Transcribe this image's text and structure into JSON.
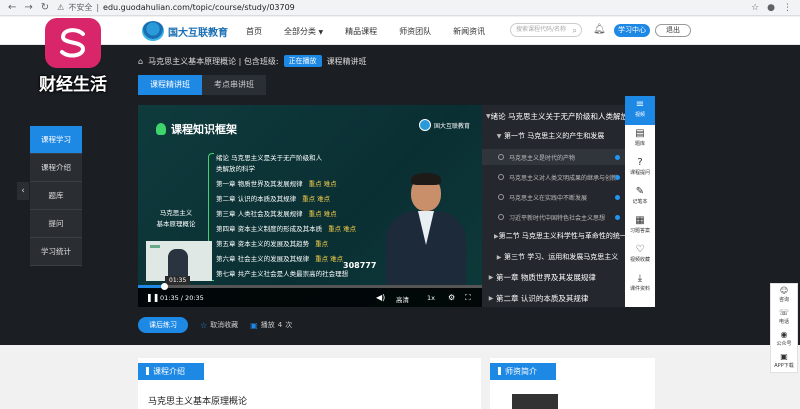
{
  "browser": {
    "security": "不安全",
    "url": "edu.guodahulian.com/topic/course/study/03709"
  },
  "watermark": {
    "text": "财经生活"
  },
  "header": {
    "logo_text": "国大互联教育",
    "nav": [
      "首页",
      "全部分类",
      "精品课程",
      "师资团队",
      "新闻资讯"
    ],
    "search_placeholder": "搜索课程代码/名称",
    "study_center": "学习中心",
    "exit": "退出"
  },
  "breadcrumb": {
    "course": "马克思主义基本原理概论 | 包含班级:",
    "status": "正在播放",
    "class": "课程精讲班"
  },
  "tabs": [
    "课程精讲班",
    "考点串讲班"
  ],
  "left_menu": [
    "课程学习",
    "课程介绍",
    "题库",
    "提问",
    "学习统计"
  ],
  "video": {
    "slide_title": "课程知识框架",
    "logo_text": "国大互联教育",
    "subject_line1": "马克思主义",
    "subject_line2": "基本原理概论",
    "outline": [
      {
        "text": "绪论  马克思主义是关于无产阶级和人",
        "keys": ""
      },
      {
        "text": "类解放的科学",
        "keys": ""
      },
      {
        "text": "第一章  物质世界及其发展规律",
        "keys": "重点   难点"
      },
      {
        "text": "第二章  认识的本质及其规律",
        "keys": "重点   难点"
      },
      {
        "text": "第三章  人类社会及其发展规律",
        "keys": "重点   难点"
      },
      {
        "text": "第四章  资本主义制度的形成及其本质",
        "keys": "重点   难点"
      },
      {
        "text": "第五章  资本主义的发展及其趋势",
        "keys": "重点"
      },
      {
        "text": "第六章  社会主义的发展及其规律",
        "keys": "重点   难点"
      },
      {
        "text": "第七章  共产主义社会是人类最崇高的社会理想",
        "keys": ""
      }
    ],
    "counter": "308777",
    "hover_time": "01:35",
    "time": "01:35 / 20:35",
    "progress": 0.077,
    "quality": "高清",
    "speed": "1x"
  },
  "chapters": [
    {
      "level": 0,
      "text": "绪论 马克思主义关于无产阶级和人类解放的科学",
      "expanded": true
    },
    {
      "level": 1,
      "text": "第一节 马克思主义的产生和发展",
      "expanded": true
    },
    {
      "level": 2,
      "text": "马克思主义是时代的产物",
      "current": true
    },
    {
      "level": 2,
      "text": "马克思主义对人类文明成果的继承与创新",
      "current": false
    },
    {
      "level": 2,
      "text": "马克思主义在实践中不断发展",
      "current": false
    },
    {
      "level": 2,
      "text": "习近平新时代中国特色社会主义思想",
      "current": false
    },
    {
      "level": 1,
      "text": "第二节 马克思主义科学性与革命性的统一",
      "expanded": false
    },
    {
      "level": 1,
      "text": "第三节 学习、运用和发展马克思主义",
      "expanded": false
    },
    {
      "level": 0,
      "text": "第一章 物质世界及其发展规律",
      "expanded": false
    },
    {
      "level": 0,
      "text": "第二章 认识的本质及其规律",
      "expanded": false
    }
  ],
  "right_tools": [
    {
      "icon": "≡",
      "label": "视频"
    },
    {
      "icon": "▤",
      "label": "题库"
    },
    {
      "icon": "?",
      "label": "课程提问"
    },
    {
      "icon": "✎",
      "label": "记笔本"
    },
    {
      "icon": "▦",
      "label": "习题答案"
    },
    {
      "icon": "♡",
      "label": "视频收藏"
    },
    {
      "icon": "⤓",
      "label": "课件资料"
    }
  ],
  "actions": {
    "practice": "课后练习",
    "favorite": "取消收藏",
    "play_prefix": "播放",
    "play_count": "4",
    "play_suffix": "次"
  },
  "lower": {
    "intro_title": "课程介绍",
    "intro_course": "马克思主义基本原理概论",
    "teacher_title": "师资简介"
  },
  "float_tools": [
    {
      "icon": "☺",
      "label": "咨询"
    },
    {
      "icon": "☏",
      "label": "电话"
    },
    {
      "icon": "◉",
      "label": "公众号"
    },
    {
      "icon": "▣",
      "label": "APP下载"
    }
  ],
  "colors": {
    "accent": "#1e88e5",
    "highlight": "#f6d04a",
    "brace": "#3fd46b"
  }
}
